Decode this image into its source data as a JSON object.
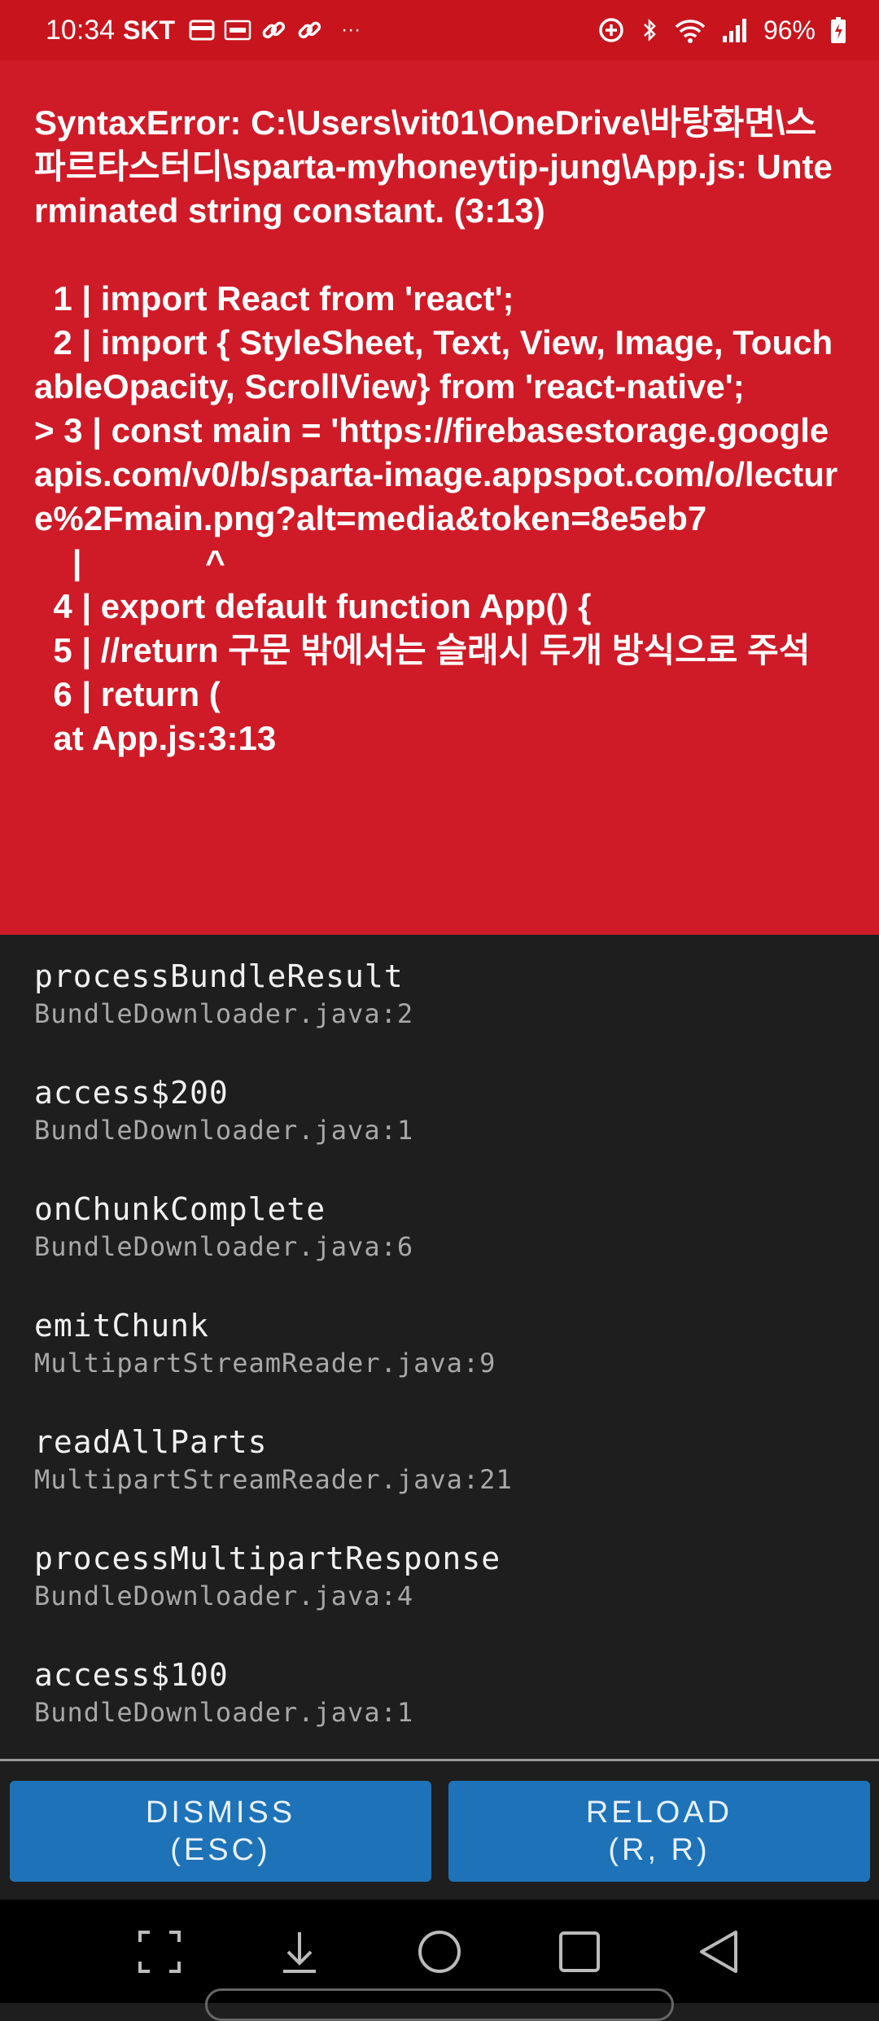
{
  "status_bar": {
    "time": "10:34",
    "carrier": "SKT",
    "battery_percent": "96%",
    "more_indicator": "···",
    "left_icons": [
      "wallet-icon",
      "payco-icon",
      "link-icon",
      "link-icon"
    ],
    "right_icons": [
      "data-saver-icon",
      "bluetooth-icon",
      "wifi-icon",
      "signal-icon",
      "battery-charging-icon"
    ]
  },
  "error": {
    "message": "SyntaxError: C:\\Users\\vit01\\OneDrive\\바탕화면\\스파르타스터디\\sparta-myhoneytip-jung\\App.js: Unterminated string constant. (3:13)\n\n  1 | import React from 'react';\n  2 | import { StyleSheet, Text, View, Image, TouchableOpacity, ScrollView} from 'react-native';\n> 3 | const main = 'https://firebasestorage.googleapis.com/v0/b/sparta-image.appspot.com/o/lecture%2Fmain.png?alt=media&token=8e5eb7\n    |             ^\n  4 | export default function App() {\n  5 | //return 구문 밖에서는 슬래시 두개 방식으로 주석\n  6 | return (\n  at App.js:3:13"
  },
  "stack_trace": [
    {
      "method": "processBundleResult",
      "file": "BundleDownloader.java:2"
    },
    {
      "method": "access$200",
      "file": "BundleDownloader.java:1"
    },
    {
      "method": "onChunkComplete",
      "file": "BundleDownloader.java:6"
    },
    {
      "method": "emitChunk",
      "file": "MultipartStreamReader.java:9"
    },
    {
      "method": "readAllParts",
      "file": "MultipartStreamReader.java:21"
    },
    {
      "method": "processMultipartResponse",
      "file": "BundleDownloader.java:4"
    },
    {
      "method": "access$100",
      "file": "BundleDownloader.java:1"
    }
  ],
  "buttons": {
    "dismiss_label": "DISMISS",
    "dismiss_shortcut": "(ESC)",
    "reload_label": "RELOAD",
    "reload_shortcut": "(R, R)"
  },
  "nav_bar": {
    "icons": [
      "screenshot-frame-icon",
      "download-icon",
      "home-icon",
      "recents-icon",
      "back-icon"
    ]
  },
  "colors": {
    "status_bar_bg": "#c8141c",
    "error_bg": "#cf1a27",
    "stack_bg": "#1e1e1e",
    "button_bg": "#1e72b8"
  }
}
